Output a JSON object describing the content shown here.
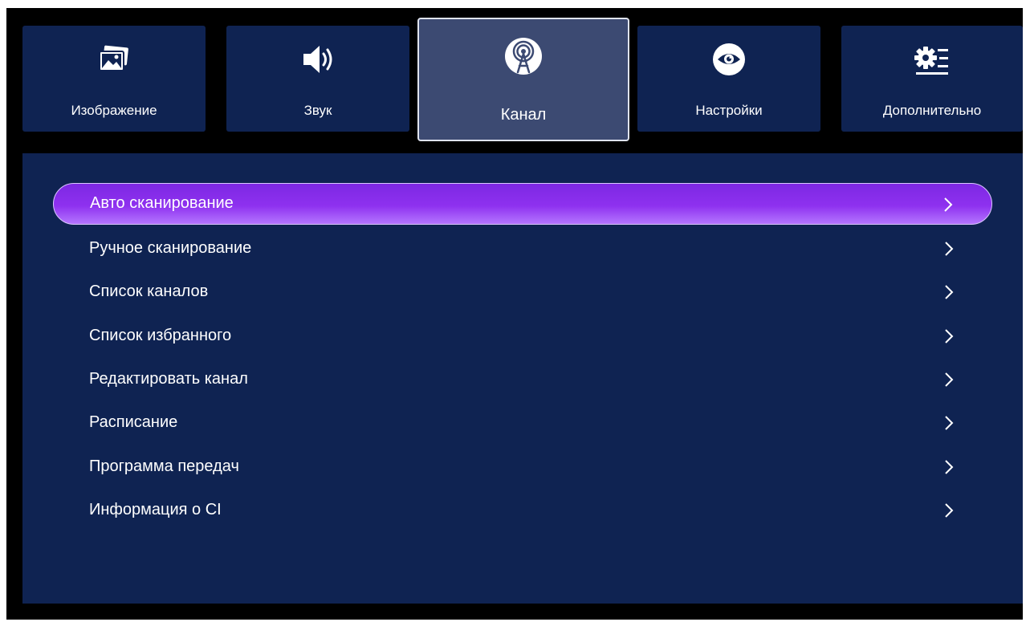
{
  "tabs": [
    {
      "label": "Изображение",
      "icon": "picture-icon"
    },
    {
      "label": "Звук",
      "icon": "speaker-icon"
    },
    {
      "label": "Канал",
      "icon": "antenna-icon"
    },
    {
      "label": "Настройки",
      "icon": "eye-icon"
    },
    {
      "label": "Дополнительно",
      "icon": "gear-list-icon"
    }
  ],
  "active_tab": "Канал",
  "menu": {
    "items": [
      {
        "label": "Авто сканирование"
      },
      {
        "label": "Ручное сканирование"
      },
      {
        "label": "Список каналов"
      },
      {
        "label": "Список избранного"
      },
      {
        "label": "Редактировать канал"
      },
      {
        "label": "Расписание"
      },
      {
        "label": "Программа передач"
      },
      {
        "label": "Информация о CI"
      }
    ],
    "selected_item": "Авто сканирование"
  },
  "colors": {
    "background": "#000000",
    "panel": "#0f2352",
    "active_tab": "#3c4a72",
    "selection_accent": "#8e31ef",
    "text": "#ffffff"
  }
}
